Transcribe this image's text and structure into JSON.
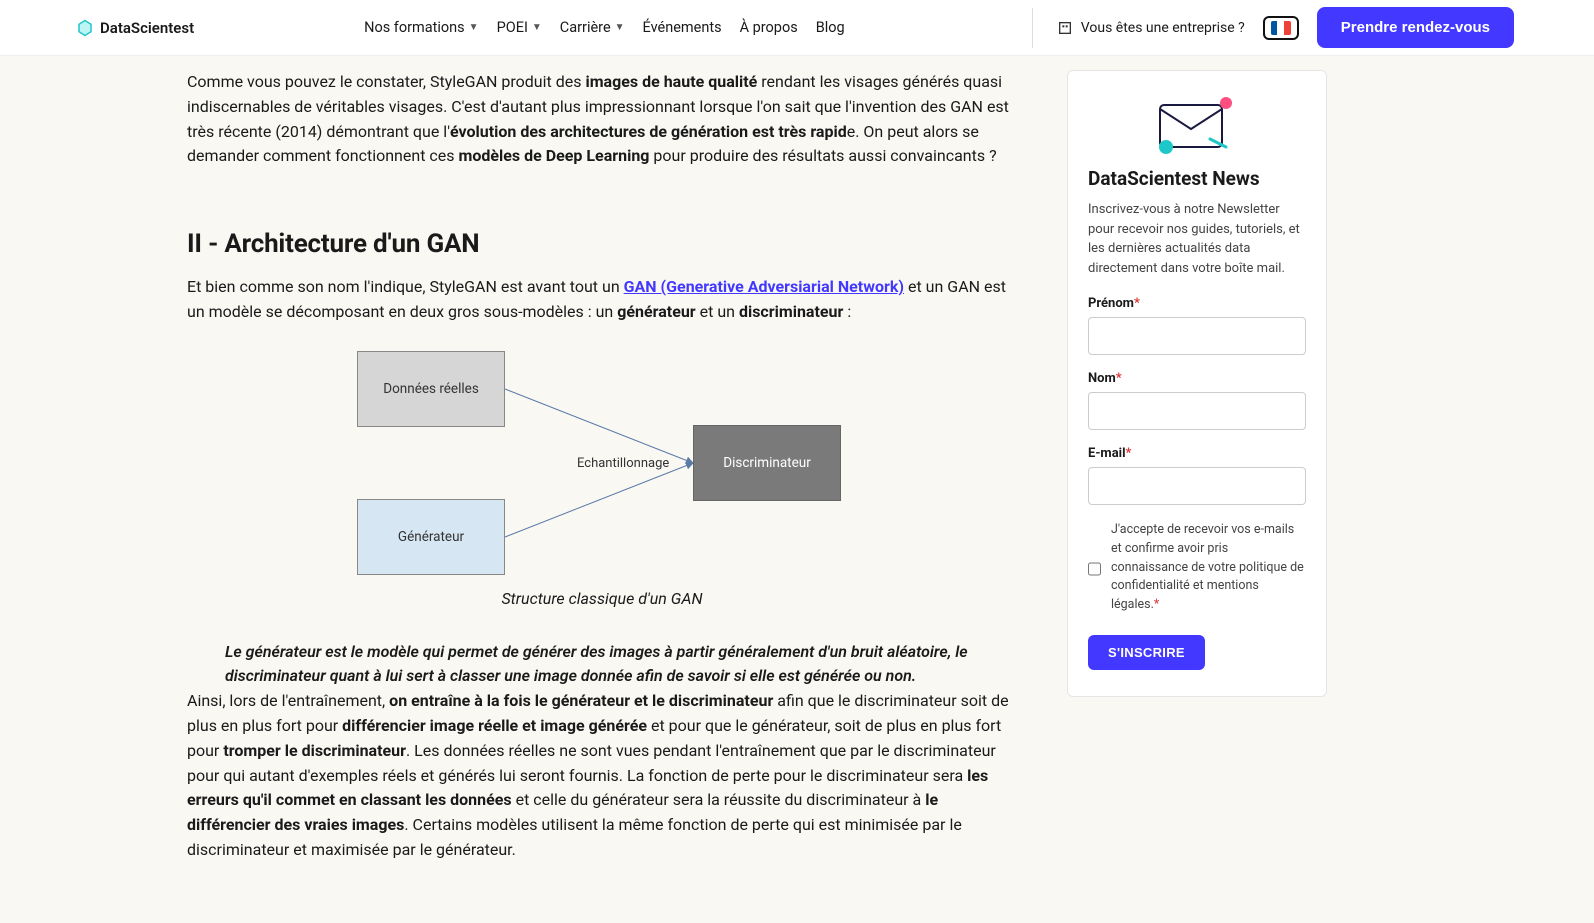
{
  "header": {
    "brand": "DataScientest",
    "nav": {
      "formations": "Nos formations",
      "poei": "POEI",
      "carriere": "Carrière",
      "evenements": "Événements",
      "apropos": "À propos",
      "blog": "Blog"
    },
    "enterprise_question": "Vous êtes une entreprise ?",
    "flag_colors": {
      "left": "#0055A4",
      "mid": "#ffffff",
      "right": "#EF4135"
    },
    "cta": "Prendre rendez-vous"
  },
  "article": {
    "p1": {
      "a": "Comme vous pouvez le constater, StyleGAN produit des ",
      "b": "images de haute qualité",
      "c": " rendant les visages générés quasi indiscernables de véritables visages. C'est d'autant plus impressionnant lorsque l'on sait que l'invention des GAN est très récente (2014) démontrant que l'",
      "d": "évolution des architectures de génération est très rapid",
      "e": "e. On peut alors se demander comment fonctionnent ces ",
      "f": "modèles de Deep Learning",
      "g": " pour produire des résultats aussi convaincants ?"
    },
    "h2": "II - Architecture d'un GAN",
    "p2": {
      "a": "Et bien comme son nom l'indique, StyleGAN est avant tout un ",
      "link": "GAN (Generative Adversiarial Network)",
      "b": " et un GAN est un modèle se décomposant en deux gros sous-modèles : un ",
      "c": "générateur",
      "d": " et un ",
      "e": "discriminateur",
      "f": " :"
    },
    "diagram": {
      "realdata": "Données réelles",
      "generator": "Générateur",
      "sampling": "Echantillonnage",
      "discriminator": "Discriminateur",
      "caption": "Structure classique d'un GAN"
    },
    "quote": "Le générateur est le modèle qui permet de générer des images à partir généralement d'un bruit aléatoire, le discriminateur quant à lui sert à classer une image donnée afin de savoir si elle est générée ou non.",
    "p3": {
      "a": "Ainsi, lors de l'entraînement, ",
      "b": "on entraîne à la fois le générateur et le discriminateur",
      "c": " afin que le discriminateur soit de plus en plus fort pour ",
      "d": "différencier image réelle et image générée",
      "e": " et pour que le générateur, soit de plus en plus fort pour ",
      "f": "tromper le discriminateur",
      "g": ". Les données réelles ne sont vues pendant l'entraînement que par le discriminateur pour qui autant d'exemples réels et générés lui seront fournis. La fonction de perte pour le discriminateur sera ",
      "h": "les erreurs qu'il commet en classant les données",
      "i": " et celle du générateur sera la réussite du discriminateur à ",
      "j": "le différencier des vraies images",
      "k": ". Certains modèles utilisent la même fonction de perte qui est minimisée par le discriminateur et maximisée par le générateur."
    }
  },
  "sidebar": {
    "title": "DataScientest News",
    "desc": "Inscrivez-vous à notre Newsletter pour recevoir nos guides, tutoriels, et les dernières actualités data directement dans votre boîte mail.",
    "labels": {
      "prenom": "Prénom",
      "nom": "Nom",
      "email": "E-mail"
    },
    "consent": "J'accepte de recevoir vos e-mails et confirme avoir pris connaissance de votre politique de confidentialité et mentions légales.",
    "submit": "S'INSCRIRE"
  }
}
